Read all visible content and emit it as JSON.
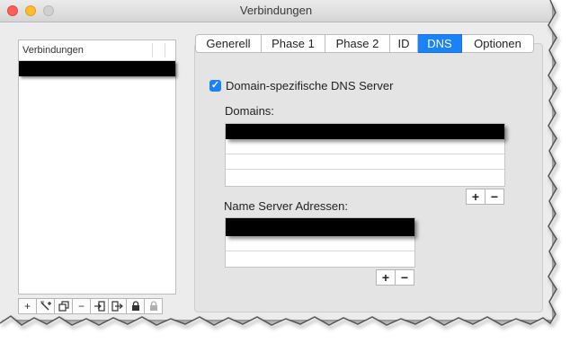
{
  "window": {
    "title": "Verbindungen"
  },
  "sidebar": {
    "column_header": "Verbindungen",
    "toolbar": [
      {
        "icon": "plus-icon",
        "glyph": "+"
      },
      {
        "icon": "magic-wand-add-icon",
        "glyph": "✨"
      },
      {
        "icon": "duplicate-icon",
        "glyph": "❐"
      },
      {
        "icon": "minus-icon",
        "glyph": "−"
      },
      {
        "icon": "import-icon",
        "glyph": "⇥"
      },
      {
        "icon": "export-icon",
        "glyph": "⇤"
      },
      {
        "icon": "lock-icon",
        "glyph": "🔒"
      },
      {
        "icon": "unlock-icon",
        "glyph": "🔓"
      }
    ]
  },
  "tabs": [
    {
      "label": "Generell",
      "active": false
    },
    {
      "label": "Phase 1",
      "active": false
    },
    {
      "label": "Phase 2",
      "active": false
    },
    {
      "label": "ID",
      "active": false
    },
    {
      "label": "DNS",
      "active": true
    },
    {
      "label": "Optionen",
      "active": false
    }
  ],
  "dns": {
    "checkbox_label": "Domain-spezifische DNS Server",
    "checked": true,
    "domains_label": "Domains:",
    "nameservers_label": "Name Server Adressen:",
    "add_glyph": "+",
    "remove_glyph": "−"
  },
  "colors": {
    "accent": "#1a82fb",
    "window_bg": "#ececec",
    "panel_bg": "#e4e4e4"
  }
}
